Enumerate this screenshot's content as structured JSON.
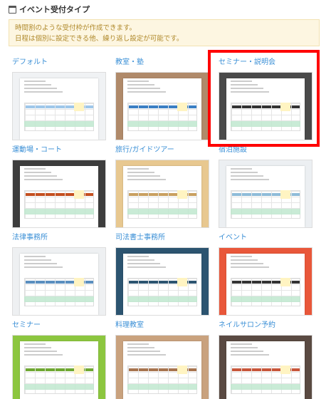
{
  "header": {
    "title": "イベント受付タイプ",
    "icon": "calendar-icon"
  },
  "notice": {
    "line1": "時間割のような受付枠が作成できます。",
    "line2": "日程は個別に設定できる他、繰り返し設定が可能です。"
  },
  "templates": [
    {
      "label": "デフォルト",
      "bg": "#f0f2f4",
      "bar": "#9ec7ea",
      "selected": false
    },
    {
      "label": "教室・塾",
      "bg": "#b08a6a",
      "bar": "#3a7fc4",
      "selected": false
    },
    {
      "label": "セミナー・説明会",
      "bg": "#4a4a4a",
      "bar": "#333333",
      "selected": true
    },
    {
      "label": "運動場・コート",
      "bg": "#3d3d3d",
      "bar": "#c45020",
      "selected": false
    },
    {
      "label": "旅行/ガイドツアー",
      "bg": "#e8c890",
      "bar": "#c9a060",
      "selected": false
    },
    {
      "label": "宿泊施設",
      "bg": "#eceff2",
      "bar": "#8fbcd9",
      "selected": false
    },
    {
      "label": "法律事務所",
      "bg": "#eef0f2",
      "bar": "#5a8fbf",
      "selected": false
    },
    {
      "label": "司法書士事務所",
      "bg": "#2c5470",
      "bar": "#2c5470",
      "selected": false
    },
    {
      "label": "イベント",
      "bg": "#e9573a",
      "bar": "#333333",
      "selected": false
    },
    {
      "label": "セミナー",
      "bg": "#8cc63f",
      "bar": "#6fa832",
      "selected": false
    },
    {
      "label": "料理教室",
      "bg": "#c9a27e",
      "bar": "#a8744f",
      "selected": false
    },
    {
      "label": "ネイルサロン予約",
      "bg": "#5a4a42",
      "bar": "#c8563a",
      "selected": false
    }
  ]
}
